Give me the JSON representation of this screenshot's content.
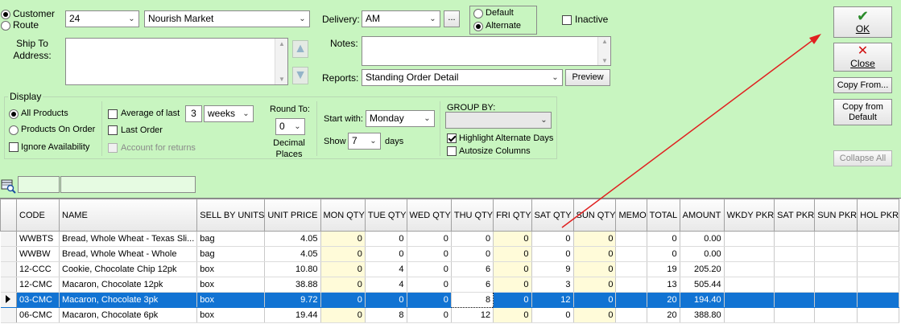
{
  "customer_mode": {
    "customer_label": "Customer",
    "route_label": "Route",
    "selected": "customer"
  },
  "customer_id": "24",
  "customer_name": "Nourish Market",
  "ship_to_label": "Ship To\nAddress:",
  "delivery": {
    "label": "Delivery:",
    "value": "AM",
    "browse_label": "..."
  },
  "delivery_type": {
    "default_label": "Default",
    "alternate_label": "Alternate",
    "selected": "alternate"
  },
  "inactive_label": "Inactive",
  "notes_label": "Notes:",
  "reports": {
    "label": "Reports:",
    "value": "Standing Order Detail",
    "preview_label": "Preview"
  },
  "buttons": {
    "ok": "OK",
    "close": "Close",
    "copy_from": "Copy From...",
    "copy_from_default": "Copy from Default",
    "collapse_all": "Collapse All"
  },
  "display": {
    "title": "Display",
    "all_products": "All Products",
    "products_on_order": "Products On Order",
    "ignore_availability": "Ignore Availability",
    "average_of_last": "Average of last",
    "average_count": "3",
    "average_unit": "weeks",
    "last_order": "Last Order",
    "account_for_returns": "Account for returns",
    "round_to_label": "Round To:",
    "round_to_value": "0",
    "decimal_places_label": "Decimal\nPlaces",
    "start_with_label": "Start with:",
    "start_with_value": "Monday",
    "show_label": "Show",
    "show_value": "7",
    "days_label": "days",
    "group_by_label": "GROUP BY:",
    "group_by_value": "",
    "highlight_alternate_days": "Highlight Alternate Days",
    "autosize_columns": "Autosize Columns"
  },
  "grid": {
    "columns": [
      "CODE",
      "NAME",
      "SELL BY UNITS",
      "UNIT PRICE",
      "MON QTY",
      "TUE QTY",
      "WED QTY",
      "THU QTY",
      "FRI QTY",
      "SAT QTY",
      "SUN QTY",
      "MEMO",
      "TOTAL",
      "AMOUNT",
      "WKDY PKR",
      "SAT PKR",
      "SUN PKR",
      "HOL PKR"
    ],
    "rows": [
      {
        "code": "WWBTS",
        "name": "Bread, Whole Wheat - Texas Sli...",
        "unit": "bag",
        "price": "4.05",
        "mon": "0",
        "tue": "0",
        "wed": "0",
        "thu": "0",
        "fri": "0",
        "sat": "0",
        "sun": "0",
        "memo": "",
        "total": "0",
        "amount": "0.00"
      },
      {
        "code": "WWBW",
        "name": "Bread, Whole Wheat - Whole",
        "unit": "bag",
        "price": "4.05",
        "mon": "0",
        "tue": "0",
        "wed": "0",
        "thu": "0",
        "fri": "0",
        "sat": "0",
        "sun": "0",
        "memo": "",
        "total": "0",
        "amount": "0.00"
      },
      {
        "code": "12-CCC",
        "name": "Cookie, Chocolate Chip 12pk",
        "unit": "box",
        "price": "10.80",
        "mon": "0",
        "tue": "4",
        "wed": "0",
        "thu": "6",
        "fri": "0",
        "sat": "9",
        "sun": "0",
        "memo": "",
        "total": "19",
        "amount": "205.20"
      },
      {
        "code": "12-CMC",
        "name": "Macaron, Chocolate 12pk",
        "unit": "box",
        "price": "38.88",
        "mon": "0",
        "tue": "4",
        "wed": "0",
        "thu": "6",
        "fri": "0",
        "sat": "3",
        "sun": "0",
        "memo": "",
        "total": "13",
        "amount": "505.44"
      },
      {
        "code": "03-CMC",
        "name": "Macaron, Chocolate 3pk",
        "unit": "box",
        "price": "9.72",
        "mon": "0",
        "tue": "0",
        "wed": "0",
        "thu": "8",
        "fri": "0",
        "sat": "12",
        "sun": "0",
        "memo": "",
        "total": "20",
        "amount": "194.40"
      },
      {
        "code": "06-CMC",
        "name": "Macaron, Chocolate 6pk",
        "unit": "box",
        "price": "19.44",
        "mon": "0",
        "tue": "8",
        "wed": "0",
        "thu": "12",
        "fri": "0",
        "sat": "0",
        "sun": "0",
        "memo": "",
        "total": "20",
        "amount": "388.80"
      }
    ],
    "selected_row": 4
  },
  "colors": {
    "background": "#c8f5c0",
    "selection": "#1173d3",
    "alt_day_fill": "#fffbd9",
    "annotation_arrow": "#e02020",
    "ok_check": "#2a8a2a",
    "close_x": "#d01010"
  }
}
